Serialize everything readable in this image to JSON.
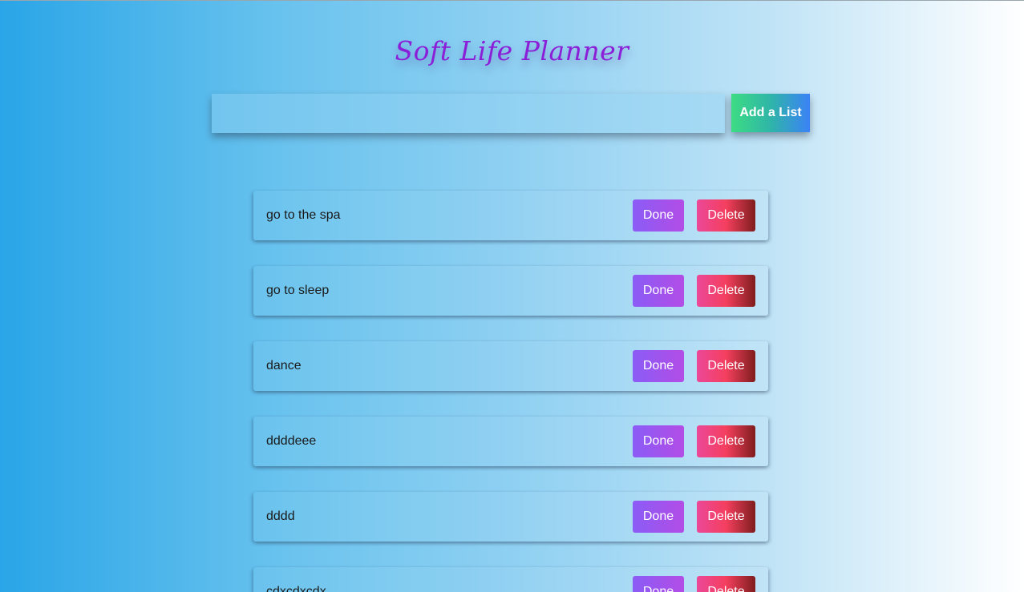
{
  "header": {
    "title": "Soft Life Planner"
  },
  "entry": {
    "value": "",
    "placeholder": "",
    "add_label": "Add a List"
  },
  "list": {
    "done_label": "Done",
    "delete_label": "Delete",
    "items": [
      {
        "text": "go to the spa"
      },
      {
        "text": "go to sleep"
      },
      {
        "text": "dance"
      },
      {
        "text": "ddddeee"
      },
      {
        "text": "dddd"
      },
      {
        "text": "cdxcdxcdx"
      }
    ]
  },
  "colors": {
    "title": "#8b1fd8",
    "done": "#8b5cf6",
    "delete": "#f43f5e",
    "add": "#3ddc84"
  }
}
